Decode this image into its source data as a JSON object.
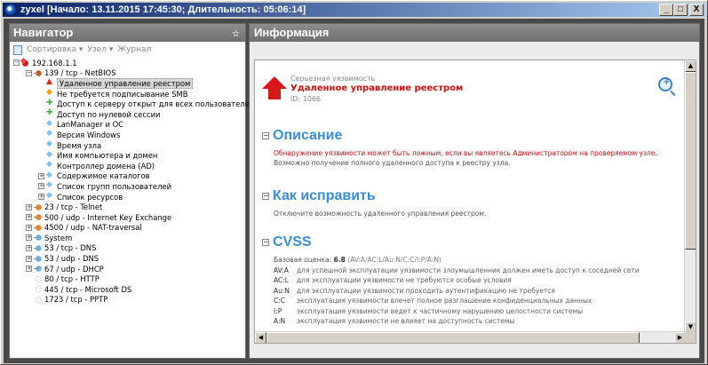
{
  "window": {
    "title": "zyxel [Начало: 13.11.2015 17:45:30; Длительность: 05:06:14]",
    "buttons": {
      "minimize": "_",
      "maximize": "□",
      "close": "X"
    }
  },
  "navigator": {
    "title": "Навигатор",
    "toolbar": {
      "sort": "Сортировка ▾",
      "node": "Узел ▾",
      "journal": "Журнал"
    },
    "tree": {
      "host": "192.168.1.1",
      "port_netbios": "139 / tcp - NetBIOS",
      "netbios_children": [
        "Удаленное управление реестром",
        "Не требуется подписывание SMB",
        "Доступ к серверу открыт для всех пользователей",
        "Доступ по нулевой сессии",
        "LanManager и ОС",
        "Версия Windows",
        "Время узла",
        "Имя компьютера и домен",
        "Контроллер домена (AD)",
        "Содержимое каталогов",
        "Список групп пользователей",
        "Список ресурсов"
      ],
      "ports": [
        "23 / tcp - Telnet",
        "500 / udp - Internet Key Exchange",
        "4500 / udp - NAT-traversal",
        "System",
        "53 / tcp - DNS",
        "53 / udp - DNS",
        "67 / udp - DHCP",
        "80 / tcp - HTTP",
        "445 / tcp - Microsoft DS",
        "1723 / tcp - PPTP"
      ]
    }
  },
  "info": {
    "title": "Информация",
    "severity": "Серьезная уязвимость",
    "vuln_name": "Удаленное управление реестром",
    "vuln_id": "ID: 1066",
    "description": {
      "title": "Описание",
      "red_line": "Обнаружение уязвимости может быть ложным, если вы являетесь Администратором на проверяемом узле.",
      "gray_line": "Возможно получение полного удаленного доступа к реестру узла."
    },
    "fix": {
      "title": "Как исправить",
      "text": "Отключите возможность удаленного управления реестром."
    },
    "cvss": {
      "title": "CVSS",
      "base_label": "Базовая оценка:",
      "base_score": "6.8",
      "base_vector": "(AV:A/AC:L/Au:N/C:C/I:P/A:N)",
      "rows": [
        {
          "key": "AV:A",
          "desc": "для успешной эксплуатации уязвимости злоумышленник должен иметь доступ к соседней сети"
        },
        {
          "key": "AC:L",
          "desc": "для эксплуатации уязвимости не требуются особые условия"
        },
        {
          "key": "Au:N",
          "desc": "для эксплуатации уязвимости проходить аутентификацию не требуется"
        },
        {
          "key": "C:C",
          "desc": "эксплуатация уязвимости влечет полное разглашение конфиденциальных данных"
        },
        {
          "key": "I:P",
          "desc": "эксплуатация уязвимости ведет к частичному нарушению целостности системы"
        },
        {
          "key": "A:N",
          "desc": "эксплуатация уязвимости не влияет на доступность системы"
        }
      ]
    }
  }
}
